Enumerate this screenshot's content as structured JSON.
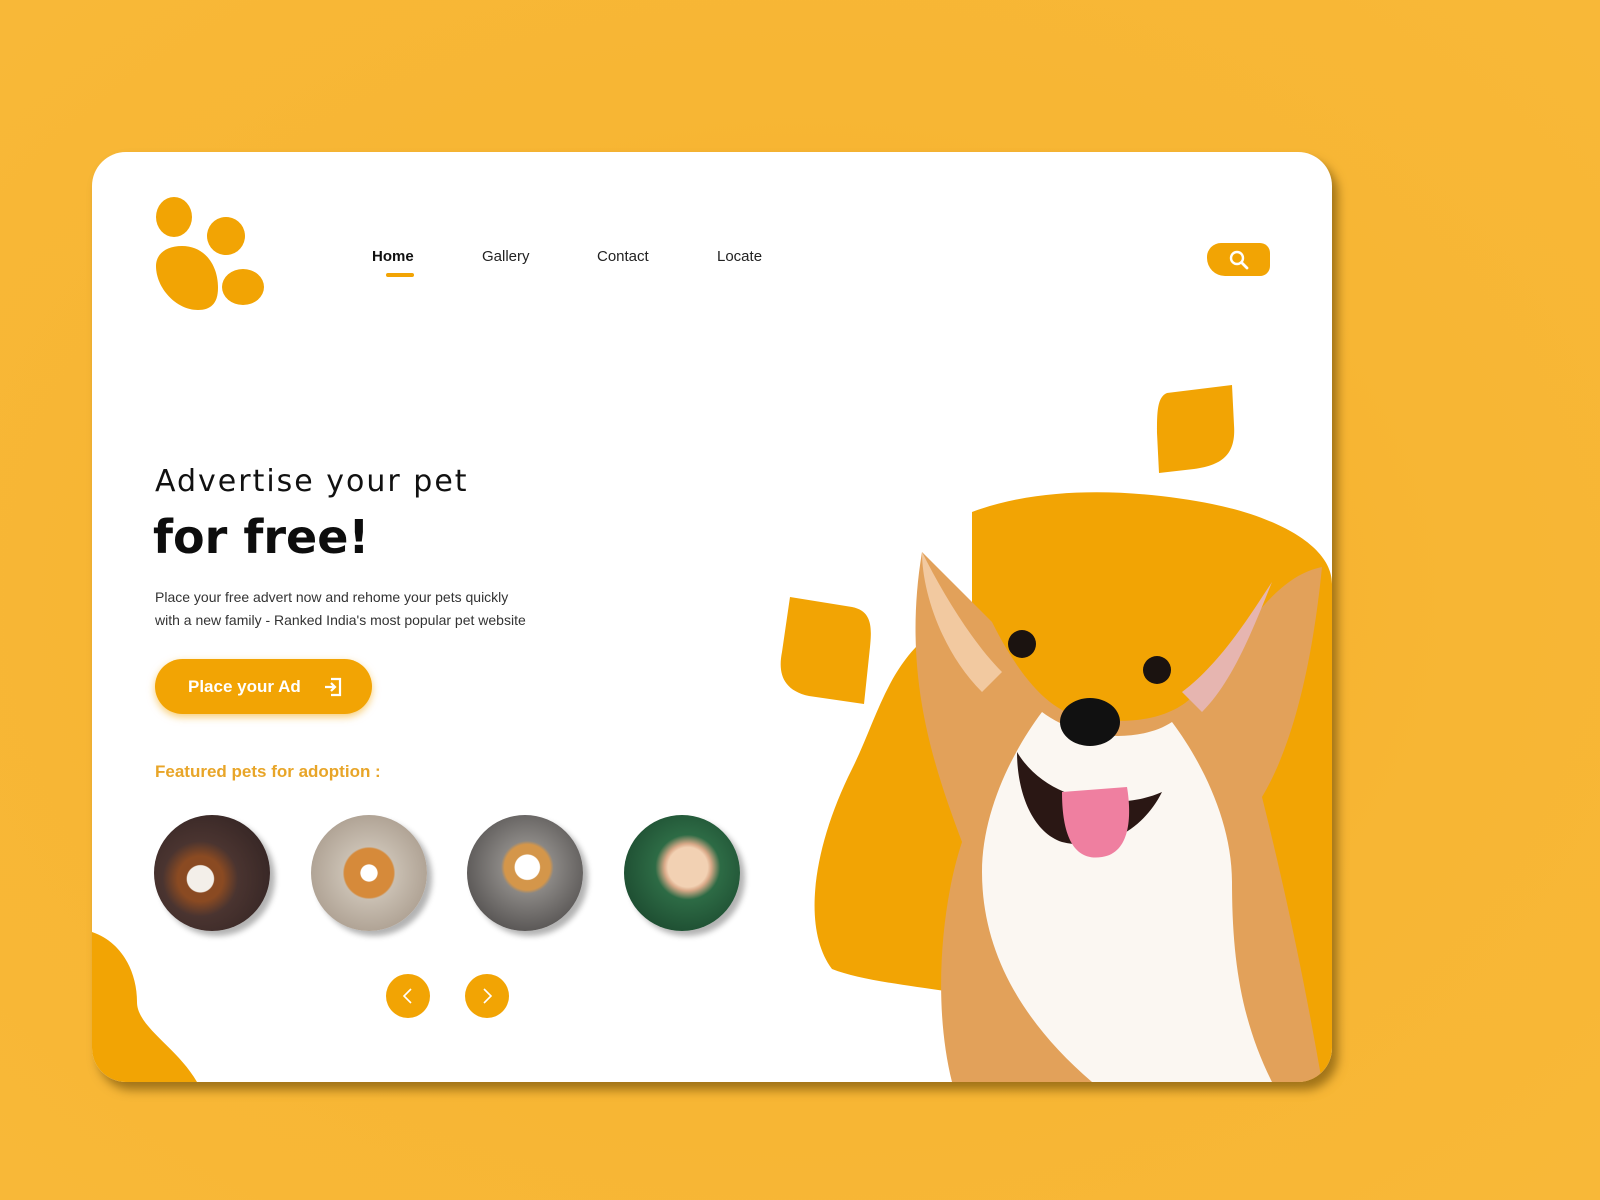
{
  "nav": {
    "items": [
      {
        "label": "Home",
        "active": true
      },
      {
        "label": "Gallery"
      },
      {
        "label": "Contact"
      },
      {
        "label": "Locate"
      }
    ]
  },
  "hero": {
    "title_line1": "Advertise your pet",
    "title_line2": "for free!",
    "description_line1": "Place your free advert now and rehome your pets quickly",
    "description_line2": "with a new family - Ranked India's most popular pet website",
    "cta_label": "Place your Ad",
    "cta_icon": "sign-in-icon"
  },
  "featured": {
    "label": "Featured pets for adoption :",
    "pets": [
      "beagle puppy",
      "corgi lying down",
      "corgi puppy",
      "kitten"
    ]
  },
  "icons": {
    "search": "search-icon",
    "prev": "chevron-left-icon",
    "next": "chevron-right-icon"
  },
  "colors": {
    "accent": "#f2a404",
    "background": "#f7b634",
    "featured_label": "#e8a528"
  }
}
